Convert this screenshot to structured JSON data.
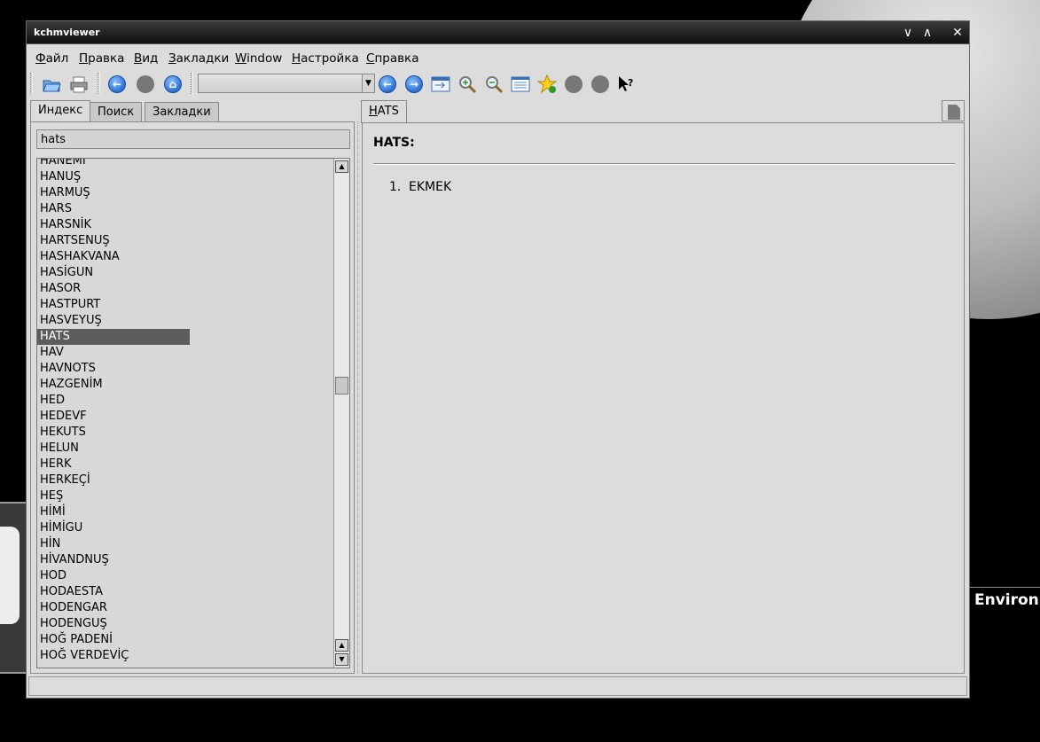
{
  "window": {
    "title": "kchmviewer",
    "buttons": [
      "∨",
      "∧",
      "✕"
    ]
  },
  "menu": [
    {
      "label": "Файл",
      "hotkey_index": 0
    },
    {
      "label": "Правка",
      "hotkey_index": 0
    },
    {
      "label": "Вид",
      "hotkey_index": 0
    },
    {
      "label": "Закладки",
      "hotkey_index": 0
    },
    {
      "label": "Window",
      "hotkey_index": 0
    },
    {
      "label": "Настройка",
      "hotkey_index": 0
    },
    {
      "label": "Справка",
      "hotkey_index": 0
    }
  ],
  "toolbar": {
    "icons": [
      "open-icon",
      "print-icon",
      "back-icon",
      "stop-icon",
      "home-icon",
      "nav-back-icon",
      "nav-forward-icon",
      "sync-toc-icon",
      "zoom-in-icon",
      "zoom-out-icon",
      "view-source-icon",
      "add-bookmark-icon",
      "prev-page-icon",
      "next-page-icon",
      "whats-this-icon"
    ],
    "combo_value": ""
  },
  "left": {
    "tabs": [
      "Индекс",
      "Поиск",
      "Закладки"
    ],
    "active_tab": "Индекс",
    "search_value": "hats",
    "items": [
      "HANEMİ",
      "HANUŞ",
      "HARMUŞ",
      "HARS",
      "HARSNİK",
      "HARTSENUŞ",
      "HASHAKVANA",
      "HASİGUN",
      "HASOR",
      "HASTPURT",
      "HASVEYUŞ",
      "HATS",
      "HAV",
      "HAVNOTS",
      "HAZGENİM",
      "HED",
      "HEDEVF",
      "HEKUTS",
      "HELUN",
      "HERK",
      "HERKEÇİ",
      "HEŞ",
      "HİMİ",
      "HİMİGU",
      "HİN",
      "HİVANDNUŞ",
      "HOD",
      "HODAESTA",
      "HODENGAR",
      "HODENGUŞ",
      "HOĞ PADENİ",
      "HOĞ VERDEVİÇ"
    ],
    "selected": "HATS"
  },
  "content": {
    "tab_label": "HATS",
    "heading": "HATS:",
    "list": [
      {
        "num": "1.",
        "text": "EKMEK"
      }
    ]
  },
  "desktop": {
    "text": "Environn"
  }
}
